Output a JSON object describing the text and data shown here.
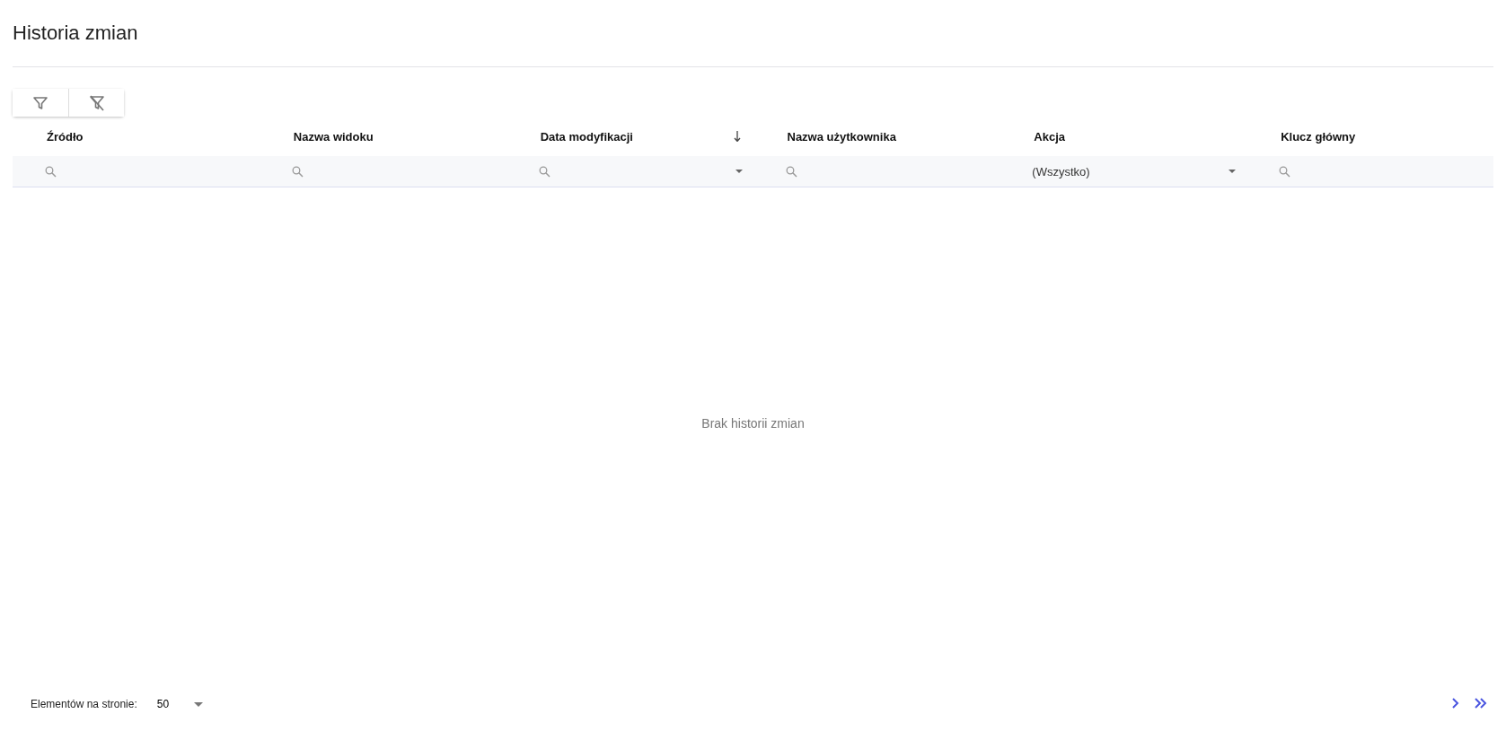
{
  "title": "Historia zmian",
  "toolbar": [
    {
      "kind": "filter"
    },
    {
      "kind": "clear-filter"
    }
  ],
  "table": {
    "columns": [
      {
        "label": "Źródło",
        "sorted": false,
        "filter": {
          "kind": "search"
        }
      },
      {
        "label": "Nazwa widoku",
        "sorted": false,
        "filter": {
          "kind": "search"
        }
      },
      {
        "label": "Data modyfikacji",
        "sorted": true,
        "filter": {
          "kind": "date"
        }
      },
      {
        "label": "Nazwa użytkownika",
        "sorted": false,
        "filter": {
          "kind": "search"
        }
      },
      {
        "label": "Akcja",
        "sorted": false,
        "filter": {
          "kind": "select",
          "value": "(Wszystko)"
        }
      },
      {
        "label": "Klucz główny",
        "sorted": false,
        "filter": {
          "kind": "search"
        }
      }
    ],
    "empty_message": "Brak historii zmian"
  },
  "pager": {
    "label": "Elementów na stronie:",
    "page_size": "50"
  }
}
